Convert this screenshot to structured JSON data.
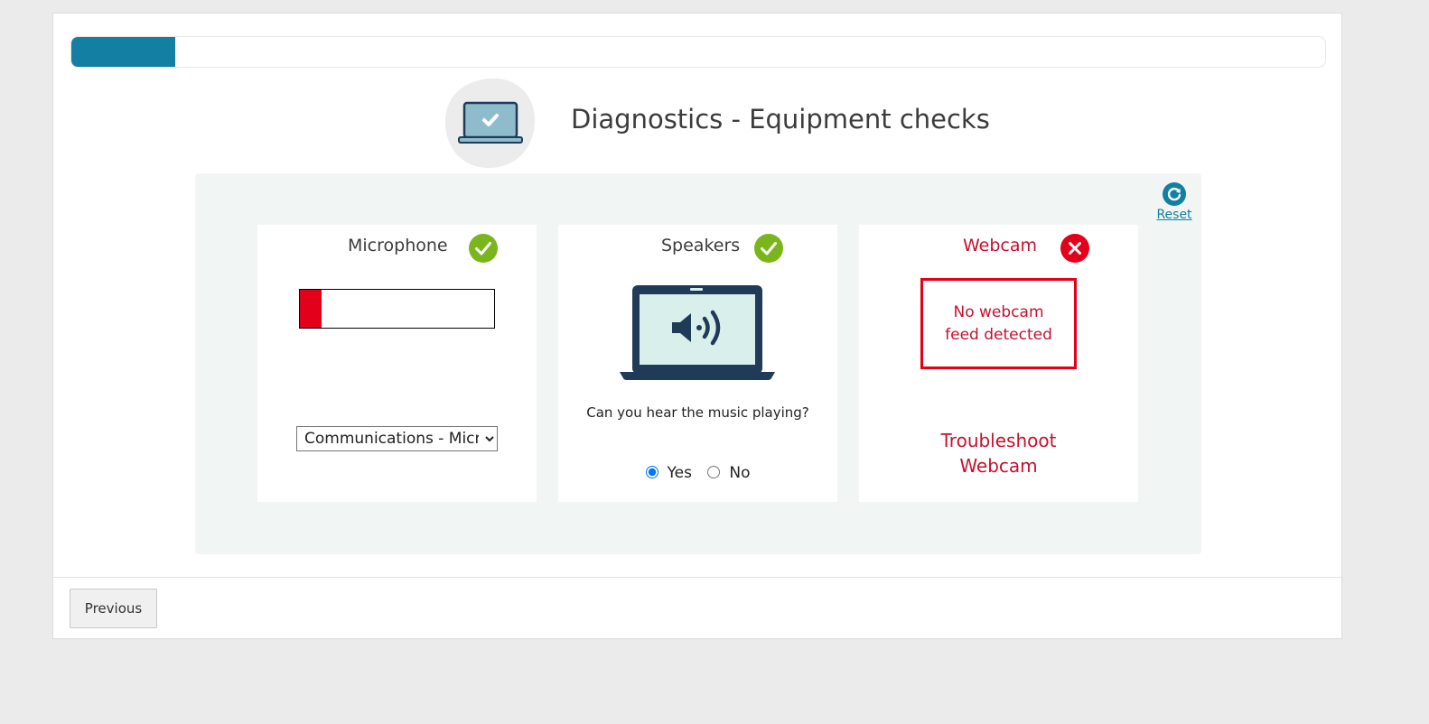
{
  "progress": {
    "percent": 8.3,
    "color": "#127fa3"
  },
  "header": {
    "icon": "laptop-check-icon",
    "title": "Diagnostics - Equipment checks"
  },
  "reset": {
    "label": "Reset",
    "icon": "refresh-icon"
  },
  "microphone": {
    "title": "Microphone",
    "status": "ok",
    "status_icon": "check-circle-icon",
    "level_percent": 11,
    "level_color": "#e2001a",
    "device_selected": "Communications - Microphone"
  },
  "speakers": {
    "title": "Speakers",
    "status": "ok",
    "status_icon": "check-circle-icon",
    "image_icon": "laptop-speaker-icon",
    "question": "Can you hear the music playing?",
    "yes_label": "Yes",
    "no_label": "No",
    "selected": "yes"
  },
  "webcam": {
    "title": "Webcam",
    "status": "error",
    "status_icon": "error-circle-icon",
    "no_feed_message": "No webcam feed detected",
    "troubleshoot_label": "Troubleshoot Webcam",
    "error_color": "#c8102e"
  },
  "footer": {
    "previous_label": "Previous"
  },
  "colors": {
    "accent": "#127fa3",
    "ok_green": "#7ab51d",
    "error_red": "#e2001a",
    "panel_bg": "#f1f6f4"
  }
}
